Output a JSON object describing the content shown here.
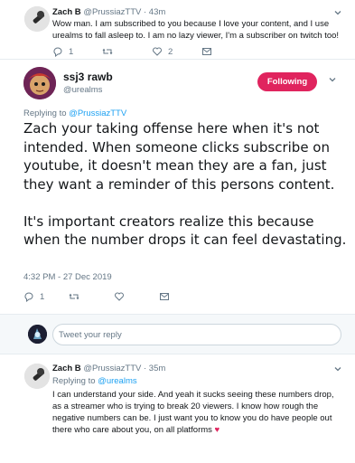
{
  "top_tweet": {
    "name": "Zach B",
    "handle": "@PrussiazTTV",
    "time": "· 43m",
    "text": "Wow man. I am subscribed to you because I love your content, and I use urealms to fall asleep to. I am no lazy viewer, I'm a subscriber on twitch too!",
    "reply_count": "1",
    "retweet_count": "",
    "like_count": "2"
  },
  "main_tweet": {
    "name": "ssj3 rawb",
    "handle": "@urealms",
    "follow_label": "Following",
    "replying_prefix": "Replying to ",
    "replying_handle": "@PrussiazTTV",
    "paragraph1": "Zach your taking offense here when it's not intended. When someone clicks subscribe on youtube, it doesn't mean they are a fan, just they want a reminder of this persons content.",
    "paragraph2": "It's important creators realize this because when the number drops it can feel devastating.",
    "timestamp": "4:32 PM - 27 Dec 2019",
    "reply_count": "1",
    "retweet_count": "",
    "like_count": ""
  },
  "reply_box": {
    "placeholder": "Tweet your reply"
  },
  "bottom_tweet": {
    "name": "Zach B",
    "handle": "@PrussiazTTV",
    "time": "· 35m",
    "replying_prefix": "Replying to ",
    "replying_handle": "@urealms",
    "text": "I can understand your side. And yeah it sucks seeing these numbers drop, as a streamer who is trying to break 20 viewers. I know how rough the negative numbers can be. I just want you to know you do have people out there who care about you, on all platforms",
    "heart": "♥"
  },
  "colors": {
    "accent": "#1da1f2",
    "follow_button": "#e0245e",
    "muted": "#657786"
  }
}
